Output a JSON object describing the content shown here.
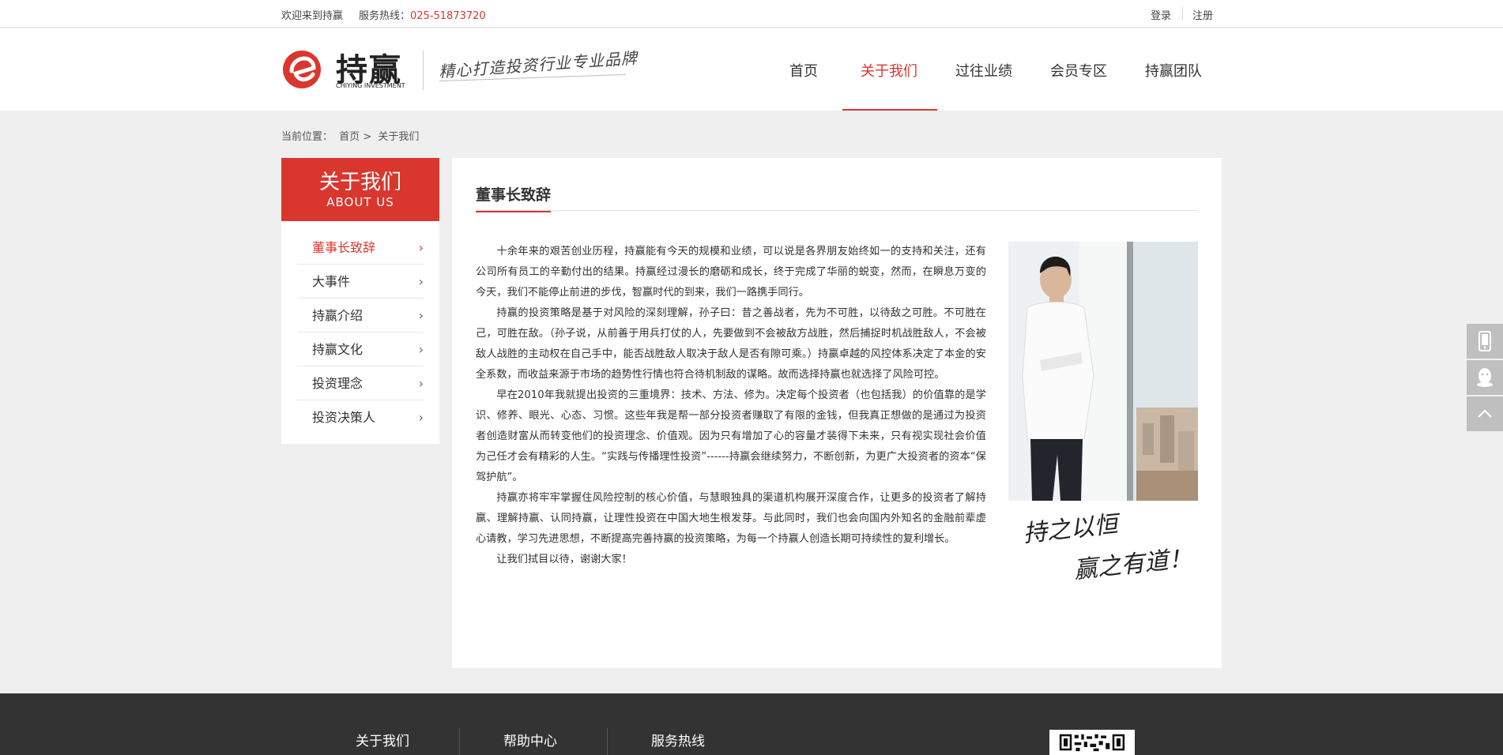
{
  "topbar": {
    "welcome": "欢迎来到持赢",
    "hotline_label": "服务热线：",
    "hotline_number": "025-51873720",
    "login": "登录",
    "register": "注册"
  },
  "brand": {
    "name_cn": "持赢",
    "name_en": "CHIYING INVESTMENT",
    "slogan": "精心打造投资行业专业品牌",
    "accent_color": "#d9372e"
  },
  "nav": {
    "items": [
      "首页",
      "关于我们",
      "过往业绩",
      "会员专区",
      "持赢团队"
    ],
    "active": "关于我们"
  },
  "breadcrumb": {
    "label": "当前位置：",
    "home": "首页",
    "separator": ">",
    "current": "关于我们"
  },
  "sidebar": {
    "title_cn": "关于我们",
    "title_en": "ABOUT US",
    "items": [
      "董事长致辞",
      "大事件",
      "持赢介绍",
      "持赢文化",
      "投资理念",
      "投资决策人"
    ],
    "active": "董事长致辞"
  },
  "content": {
    "title": "董事长致辞",
    "paragraphs": [
      "十余年来的艰苦创业历程，持赢能有今天的规模和业绩，可以说是各界朋友始终如一的支持和关注，还有公司所有员工的辛勤付出的结果。持赢经过漫长的磨砺和成长，终于完成了华丽的蜕变，然而，在瞬息万变的今天，我们不能停止前进的步伐，智赢时代的到来，我们一路携手同行。",
      "持赢的投资策略是基于对风险的深刻理解，孙子曰：昔之善战者，先为不可胜，以待敌之可胜。不可胜在己，可胜在敌。（孙子说，从前善于用兵打仗的人，先要做到不会被敌方战胜，然后捕捉时机战胜敌人，不会被敌人战胜的主动权在自己手中，能否战胜敌人取决于敌人是否有隙可乘。）持赢卓越的风控体系决定了本金的安全系数，而收益来源于市场的趋势性行情也符合待机制敌的谋略。故而选择持赢也就选择了风险可控。",
      "早在2010年我就提出投资的三重境界：技术、方法、修为。决定每个投资者（也包括我）的价值靠的是学识、修养、眼光、心态、习惯。这些年我是帮一部分投资者赚取了有限的金钱，但我真正想做的是通过为投资者创造财富从而转变他们的投资理念、价值观。因为只有增加了心的容量才装得下未来，只有视实现社会价值为己任才会有精彩的人生。“实践与传播理性投资”------持赢会继续努力，不断创新，为更广大投资者的资本“保驾护航”。",
      "持赢亦将牢牢掌握住风险控制的核心价值，与慧眼独具的渠道机构展开深度合作，让更多的投资者了解持赢、理解持赢、认同持赢，让理性投资在中国大地生根发芽。与此同时，我们也会向国内外知名的金融前辈虚心请教，学习先进思想，不断提高完善持赢的投资策略，为每一个持赢人创造长期可持续性的复利增长。",
      "让我们拭目以待，谢谢大家！"
    ],
    "signature_line1": "持之以恒",
    "signature_line2": "赢之有道！"
  },
  "float_tools": [
    "mobile-icon",
    "qq-icon",
    "back-to-top-icon"
  ],
  "footer": {
    "links": [
      "关于我们",
      "帮助中心",
      "服务热线"
    ]
  }
}
